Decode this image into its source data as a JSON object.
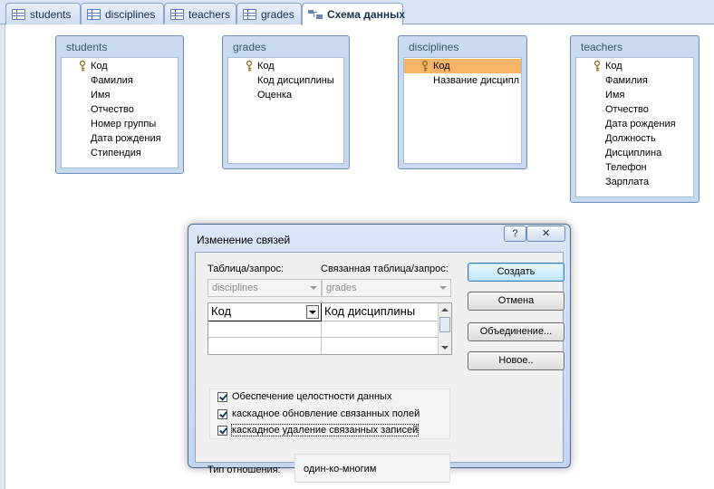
{
  "tabs": [
    {
      "label": "students",
      "icon": "table-icon"
    },
    {
      "label": "disciplines",
      "icon": "table-icon"
    },
    {
      "label": "teachers",
      "icon": "table-icon"
    },
    {
      "label": "grades",
      "icon": "table-icon"
    },
    {
      "label": "Схема данных",
      "icon": "relationships-icon",
      "active": true
    }
  ],
  "tables": {
    "students": {
      "title": "students",
      "fields": [
        "Код",
        "Фамилия",
        "Имя",
        "Отчество",
        "Номер группы",
        "Дата рождения",
        "Стипендия"
      ]
    },
    "grades": {
      "title": "grades",
      "fields": [
        "Код",
        "Код дисциплины",
        "Оценка"
      ]
    },
    "disciplines": {
      "title": "disciplines",
      "fields": [
        "Код",
        "Название дисципл"
      ]
    },
    "teachers": {
      "title": "teachers",
      "fields": [
        "Код",
        "Фамилия",
        "Имя",
        "Отчество",
        "Дата рождения",
        "Должность",
        "Дисциплина",
        "Телефон",
        "Зарплата"
      ]
    }
  },
  "dialog": {
    "title": "Изменение связей",
    "help_label": "?",
    "close_label": "✕",
    "table_label": "Таблица/запрос:",
    "related_label": "Связанная таблица/запрос:",
    "table_value": "disciplines",
    "related_value": "grades",
    "grid": {
      "left_field": "Код",
      "right_field": "Код дисциплины"
    },
    "checks": [
      {
        "label": "Обеспечение целостности данных",
        "checked": true
      },
      {
        "label": "каскадное обновление связанных полей",
        "checked": true
      },
      {
        "label": "каскадное удаление связанных записей",
        "checked": true
      }
    ],
    "relation_type_label": "Тип отношения:",
    "relation_type_value": "один-ко-многим",
    "buttons": {
      "create": "Создать",
      "cancel": "Отмена",
      "join": "Объединение...",
      "new": "Новое.."
    }
  },
  "colors": {
    "selected_field": "#f8b469",
    "table_frame": "#c9d9ee",
    "dialog_frame": "#c2d6ef"
  }
}
